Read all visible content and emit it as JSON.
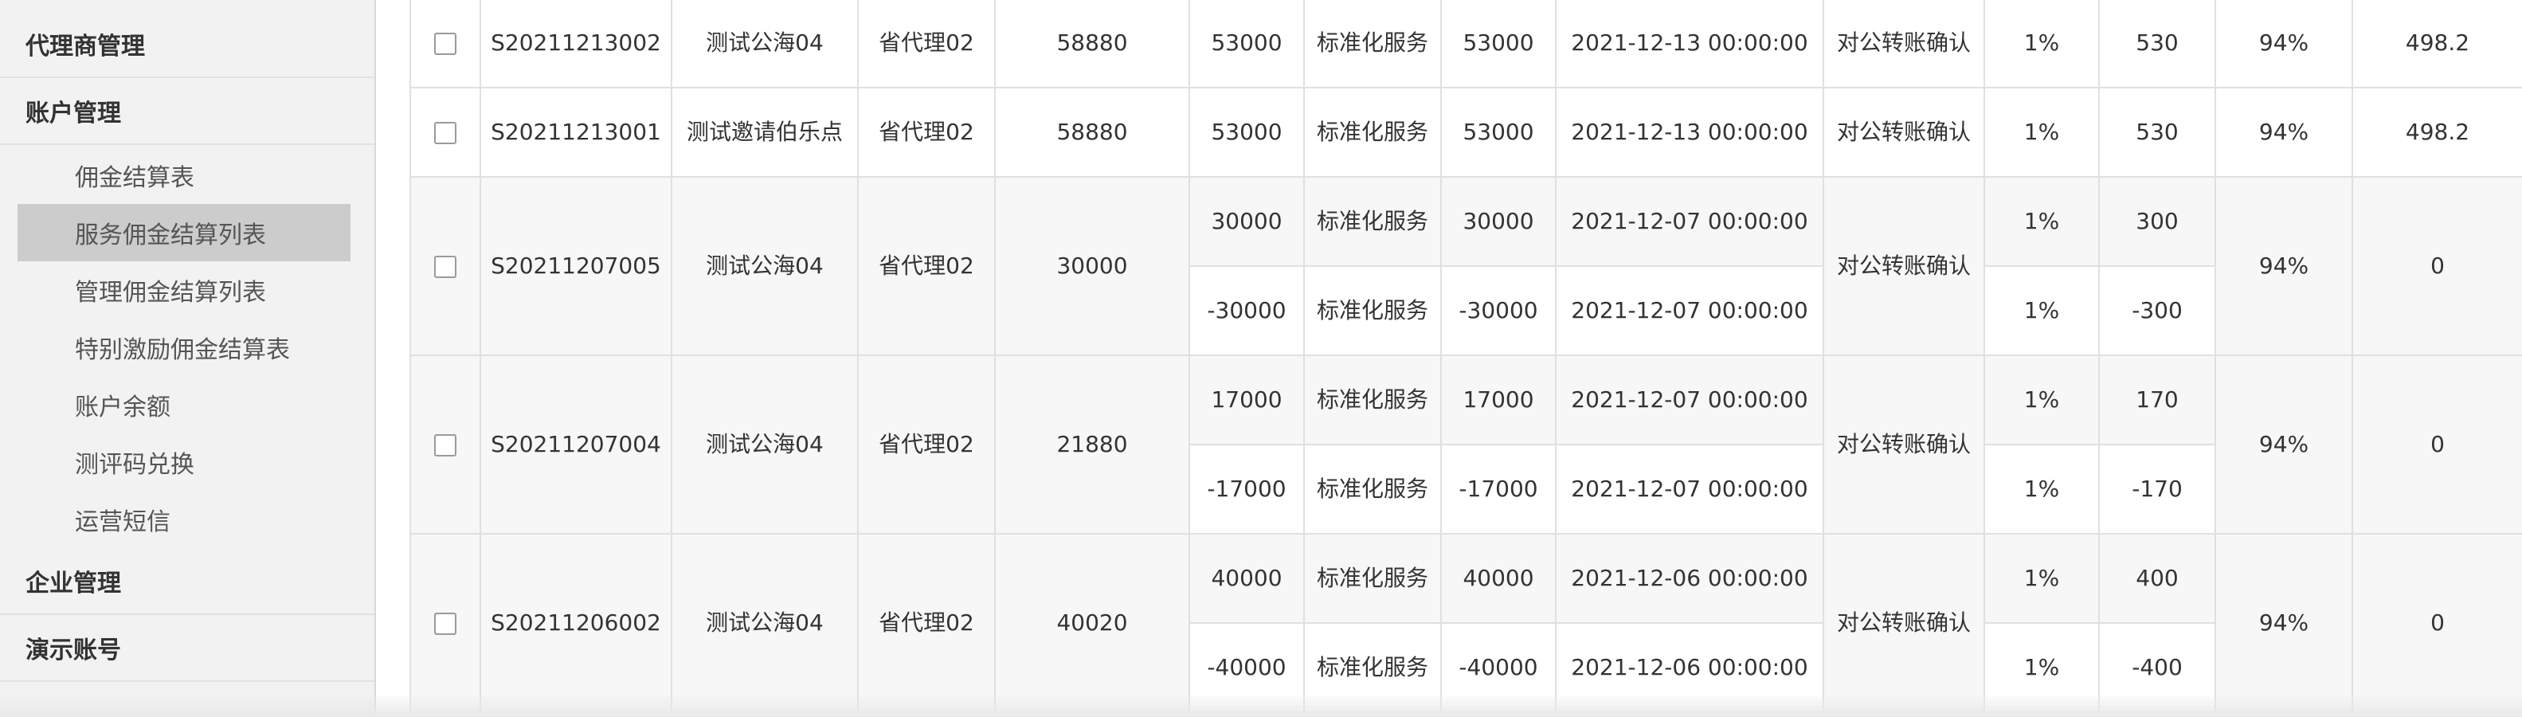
{
  "sidebar": {
    "agent_management": "代理商管理",
    "account_management": "账户管理",
    "account_items": [
      "佣金结算表",
      "服务佣金结算列表",
      "管理佣金结算列表",
      "特别激励佣金结算表",
      "账户余额",
      "测评码兑换",
      "运营短信"
    ],
    "active_item": "服务佣金结算列表",
    "enterprise_management": "企业管理",
    "demo_account": "演示账号"
  },
  "table": {
    "rows": [
      {
        "order_no": "S20211213002",
        "store": "测试公海04",
        "agent": "省代理02",
        "total": "58880",
        "entries": [
          {
            "amount": "53000",
            "service_type": "标准化服务",
            "base": "53000",
            "time": "2021-12-13 00:00:00",
            "rate": "1%",
            "commission": "530"
          }
        ],
        "status": "对公转账确认",
        "ratio": "94%",
        "net": "498.2"
      },
      {
        "order_no": "S20211213001",
        "store": "测试邀请伯乐点",
        "agent": "省代理02",
        "total": "58880",
        "entries": [
          {
            "amount": "53000",
            "service_type": "标准化服务",
            "base": "53000",
            "time": "2021-12-13 00:00:00",
            "rate": "1%",
            "commission": "530"
          }
        ],
        "status": "对公转账确认",
        "ratio": "94%",
        "net": "498.2"
      },
      {
        "order_no": "S20211207005",
        "store": "测试公海04",
        "agent": "省代理02",
        "total": "30000",
        "entries": [
          {
            "amount": "30000",
            "service_type": "标准化服务",
            "base": "30000",
            "time": "2021-12-07 00:00:00",
            "rate": "1%",
            "commission": "300"
          },
          {
            "amount": "-30000",
            "service_type": "标准化服务",
            "base": "-30000",
            "time": "2021-12-07 00:00:00",
            "rate": "1%",
            "commission": "-300"
          }
        ],
        "status": "对公转账确认",
        "ratio": "94%",
        "net": "0"
      },
      {
        "order_no": "S20211207004",
        "store": "测试公海04",
        "agent": "省代理02",
        "total": "21880",
        "entries": [
          {
            "amount": "17000",
            "service_type": "标准化服务",
            "base": "17000",
            "time": "2021-12-07 00:00:00",
            "rate": "1%",
            "commission": "170"
          },
          {
            "amount": "-17000",
            "service_type": "标准化服务",
            "base": "-17000",
            "time": "2021-12-07 00:00:00",
            "rate": "1%",
            "commission": "-170"
          }
        ],
        "status": "对公转账确认",
        "ratio": "94%",
        "net": "0"
      },
      {
        "order_no": "S20211206002",
        "store": "测试公海04",
        "agent": "省代理02",
        "total": "40020",
        "entries": [
          {
            "amount": "40000",
            "service_type": "标准化服务",
            "base": "40000",
            "time": "2021-12-06 00:00:00",
            "rate": "1%",
            "commission": "400"
          },
          {
            "amount": "-40000",
            "service_type": "标准化服务",
            "base": "-40000",
            "time": "2021-12-06 00:00:00",
            "rate": "1%",
            "commission": "-400"
          }
        ],
        "status": "对公转账确认",
        "ratio": "94%",
        "net": "0"
      }
    ]
  }
}
